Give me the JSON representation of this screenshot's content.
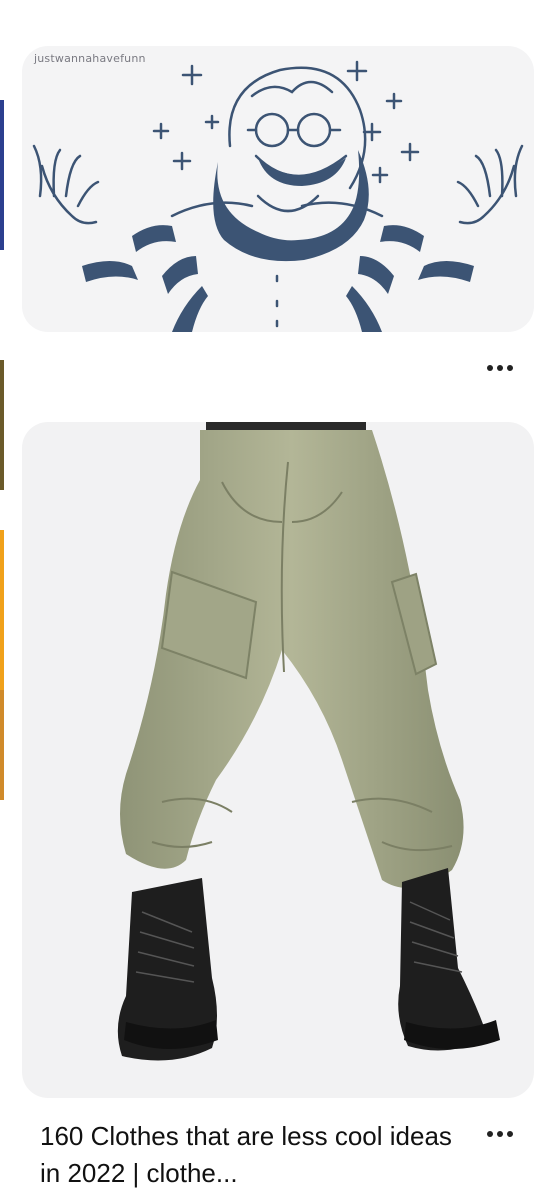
{
  "colors": {
    "page_background": "#ffffff",
    "card_background": "#f2f2f3",
    "illustration_ink": "#3c5474",
    "pants_fabric": "#a9ad8f",
    "boots": "#1e1e1e",
    "title_text": "#111111",
    "left_edge_strip": [
      "#2c3f8f",
      "#6b5a2a",
      "#f0a11a",
      "#c46b3a"
    ]
  },
  "feed": {
    "pins": [
      {
        "image_kind": "illustration",
        "icon": "cartoon-character-illustration",
        "watermark": "justwannahavefunn",
        "more_icon": "more-options-icon"
      },
      {
        "image_kind": "photo",
        "icon": "cargo-pants-photo",
        "title": "160 Clothes that are less cool ideas in 2022 | clothe...",
        "more_icon": "more-options-icon"
      }
    ]
  }
}
